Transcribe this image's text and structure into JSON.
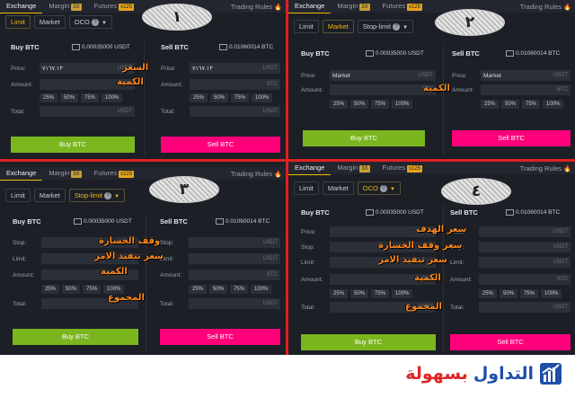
{
  "panels": [
    {
      "number": "١",
      "tabs": {
        "exchange": "Exchange",
        "margin": "Margin",
        "margin_badge": "3X",
        "futures": "Futures",
        "futures_badge": "x125",
        "trading_rules": "Trading Rules"
      },
      "order_types": {
        "a": "Limit",
        "b": "Market",
        "c": "OCO"
      },
      "buy": {
        "title": "Buy BTC",
        "balance": "0.00035000 USDT",
        "rows": [
          {
            "label": "Price:",
            "value": "",
            "unit": "USDT"
          },
          {
            "label": "Amount:",
            "value": "",
            "unit": "BTC"
          },
          {
            "label": "Total:",
            "value": "",
            "unit": "USDT"
          }
        ],
        "button": "Buy BTC"
      },
      "sell": {
        "title": "Sell BTC",
        "balance": "0.01060014 BTC",
        "rows": [
          {
            "label": "Price:",
            "value": "٧١٦٧.١٣",
            "unit": "USDT"
          },
          {
            "label": "Amount:",
            "value": "",
            "unit": "BTC"
          },
          {
            "label": "Total:",
            "value": "",
            "unit": "USDT"
          }
        ],
        "button": "Sell BTC"
      },
      "buy_price": "٧١٦٧.١٣",
      "annotations": [
        "السعر",
        "الكمية"
      ]
    },
    {
      "number": "٢",
      "tabs": {
        "exchange": "Exchange",
        "margin": "Margin",
        "margin_badge": "3X",
        "futures": "Futures",
        "futures_badge": "x125",
        "trading_rules": "Trading Rules"
      },
      "order_types": {
        "a": "Limit",
        "b": "Market",
        "c": "Stop-limit"
      },
      "buy": {
        "title": "Buy BTC",
        "balance": "0.00035000 USDT",
        "rows": [
          {
            "label": "Price:",
            "value": "Market",
            "unit": "USDT"
          },
          {
            "label": "Amount:",
            "value": "",
            "unit": "BTC"
          }
        ],
        "button": "Buy BTC"
      },
      "sell": {
        "title": "Sell BTC",
        "balance": "0.01060014 BTC",
        "rows": [
          {
            "label": "Price:",
            "value": "Market",
            "unit": "USDT"
          },
          {
            "label": "Amount:",
            "value": "",
            "unit": "BTC"
          }
        ],
        "button": "Sell BTC"
      },
      "annotations": [
        "الكمية"
      ]
    },
    {
      "number": "٣",
      "tabs": {
        "exchange": "Exchange",
        "margin": "Margin",
        "margin_badge": "3X",
        "futures": "Futures",
        "futures_badge": "x125",
        "trading_rules": "Trading Rules"
      },
      "order_types": {
        "a": "Limit",
        "b": "Market",
        "c": "Stop-limit"
      },
      "buy": {
        "title": "Buy BTC",
        "balance": "0.00035000 USDT",
        "rows": [
          {
            "label": "Stop:",
            "value": "",
            "unit": ""
          },
          {
            "label": "Limit:",
            "value": "",
            "unit": ""
          },
          {
            "label": "Amount:",
            "value": "",
            "unit": ""
          },
          {
            "label": "Total:",
            "value": "",
            "unit": ""
          }
        ],
        "button": "Buy BTC"
      },
      "sell": {
        "title": "Sell BTC",
        "balance": "0.01060014 BTC",
        "rows": [
          {
            "label": "Stop:",
            "value": "",
            "unit": "USDT"
          },
          {
            "label": "Limit:",
            "value": "",
            "unit": "USDT"
          },
          {
            "label": "Amount:",
            "value": "",
            "unit": "BTC"
          },
          {
            "label": "Total:",
            "value": "",
            "unit": "USDT"
          }
        ],
        "button": "Sell BTC"
      },
      "annotations": [
        "وقف الخسارة",
        "سعر تنفيذ الامر",
        "الكمية",
        "المجموع"
      ]
    },
    {
      "number": "٤",
      "tabs": {
        "exchange": "Exchange",
        "margin": "Margin",
        "margin_badge": "3X",
        "futures": "Futures",
        "futures_badge": "x125",
        "trading_rules": "Trading Rules"
      },
      "order_types": {
        "a": "Limit",
        "b": "Market",
        "c": "OCO"
      },
      "buy": {
        "title": "Buy BTC",
        "balance": "0.00035000 USDT",
        "rows": [
          {
            "label": "Price:",
            "value": "",
            "unit": ""
          },
          {
            "label": "Stop:",
            "value": "",
            "unit": ""
          },
          {
            "label": "Limit:",
            "value": "",
            "unit": ""
          },
          {
            "label": "Amount:",
            "value": "",
            "unit": "BTC"
          },
          {
            "label": "Total:",
            "value": "",
            "unit": "USDT"
          }
        ],
        "button": "Buy BTC"
      },
      "sell": {
        "title": "Sell BTC",
        "balance": "0.01060014 BTC",
        "rows": [
          {
            "label": "Price:",
            "value": "",
            "unit": "USDT"
          },
          {
            "label": "Stop:",
            "value": "",
            "unit": "USDT"
          },
          {
            "label": "Limit:",
            "value": "",
            "unit": "USDT"
          },
          {
            "label": "Amount:",
            "value": "",
            "unit": "BTC"
          },
          {
            "label": "Total:",
            "value": "",
            "unit": "USDT"
          }
        ],
        "button": "Sell BTC"
      },
      "annotations": [
        "سعر الهدف",
        "سعر وقف الخسارة",
        "سعر تنفيذ الامر",
        "الكمية",
        "المجموع"
      ]
    }
  ],
  "percents": [
    "25%",
    "50%",
    "75%",
    "100%"
  ],
  "brand": {
    "word1": "التداول",
    "word2": "بسهولة",
    "color_red": "#e02424",
    "color_blue": "#1e4fa8"
  },
  "colors": {
    "buy": "#7bb61f",
    "sell": "#ff007a",
    "accent": "#f0b90b",
    "annotation": "#ff8a1e",
    "divider": "#e02020"
  }
}
